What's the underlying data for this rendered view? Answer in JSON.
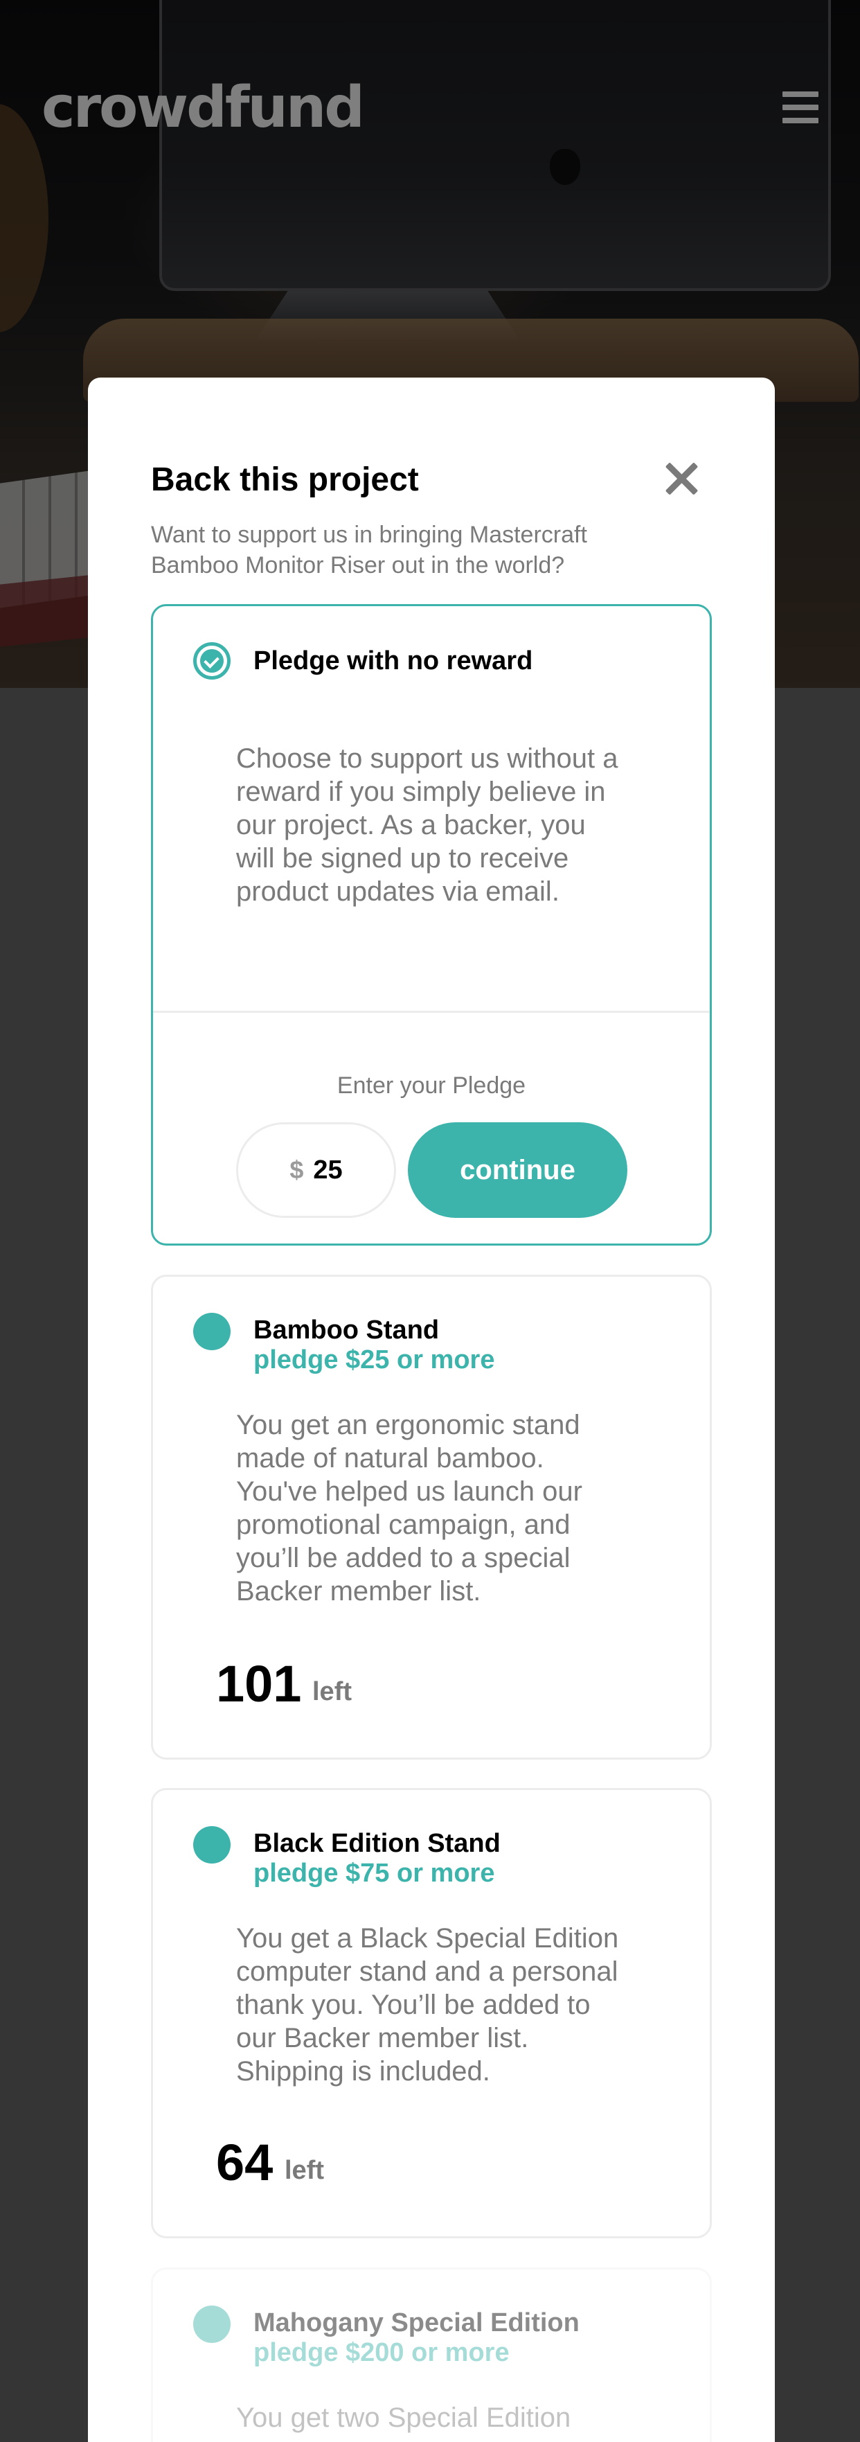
{
  "header": {
    "logo": "crowdfund"
  },
  "modal": {
    "title": "Back this project",
    "subtitle": "Want to support us in bringing Mastercraft Bamboo Monitor Riser out in the world?",
    "no_reward": {
      "title": "Pledge with no reward",
      "description": "Choose to support us without a reward if you simply believe in our project. As a backer, you will be signed up to receive product updates via email.",
      "pledge_label": "Enter your Pledge",
      "currency": "$",
      "amount": "25",
      "continue_label": "continue"
    },
    "rewards": [
      {
        "title": "Bamboo Stand",
        "price": "pledge $25 or more",
        "description": "You get an ergonomic stand made of natural bamboo. You've helped us launch our promotional campaign, and you’ll be added to a special Backer member list.",
        "left_count": "101",
        "left_label": "left"
      },
      {
        "title": "Black Edition Stand",
        "price": "pledge $75 or more",
        "description": "You get a Black Special Edition computer stand and a personal thank you. You’ll be added to our Backer member list. Shipping is included.",
        "left_count": "64",
        "left_label": "left"
      },
      {
        "title": "Mahogany Special Edition",
        "price": "pledge $200 or more",
        "description": "You get two Special Edition"
      }
    ]
  },
  "colors": {
    "accent": "#3cb3ab",
    "muted_text": "#7a7a7a",
    "border": "#ececec"
  },
  "icons": {
    "menu": "hamburger-icon",
    "close": "close-icon",
    "selected": "check-circle-icon"
  }
}
